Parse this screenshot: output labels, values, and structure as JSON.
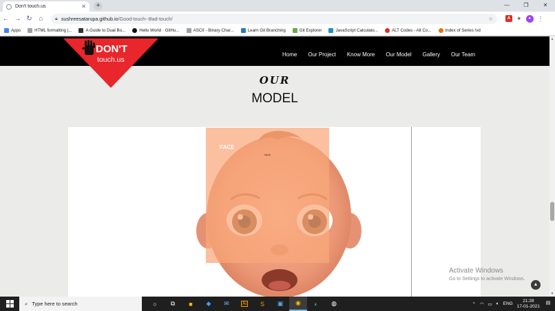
{
  "browser": {
    "tab_title": "Don't touch.us",
    "url_host": "sushreesatarupa.github.io",
    "url_path": "/Good-touch--Bad-touch/",
    "bookmarks": [
      "Apps",
      "HTML formatting |...",
      "A Guide to Dual Bo...",
      "Hello World · GitHu...",
      "ASCII - Binary Char...",
      "Learn Git Branching",
      "Git Explorer",
      "JavaScript Calculato...",
      "ALT Codes - Alt Co...",
      "Index of Series /vd"
    ]
  },
  "site": {
    "logo_line1": "DON'T",
    "logo_line2": "touch.us",
    "nav": [
      "Home",
      "Our Project",
      "Know More",
      "Our Model",
      "Gallery",
      "Our Team"
    ],
    "section_kicker": "OUR",
    "section_title": "MODEL",
    "face_label": "FACE",
    "face_label_small": "FACE",
    "brand_red": "#e8262b"
  },
  "windows_watermark": {
    "title": "Activate Windows",
    "subtitle": "Go to Settings to activate Windows."
  },
  "taskbar": {
    "search_placeholder": "Type here to search",
    "language": "ENG",
    "time": "21:28",
    "date": "17-01-2021"
  }
}
